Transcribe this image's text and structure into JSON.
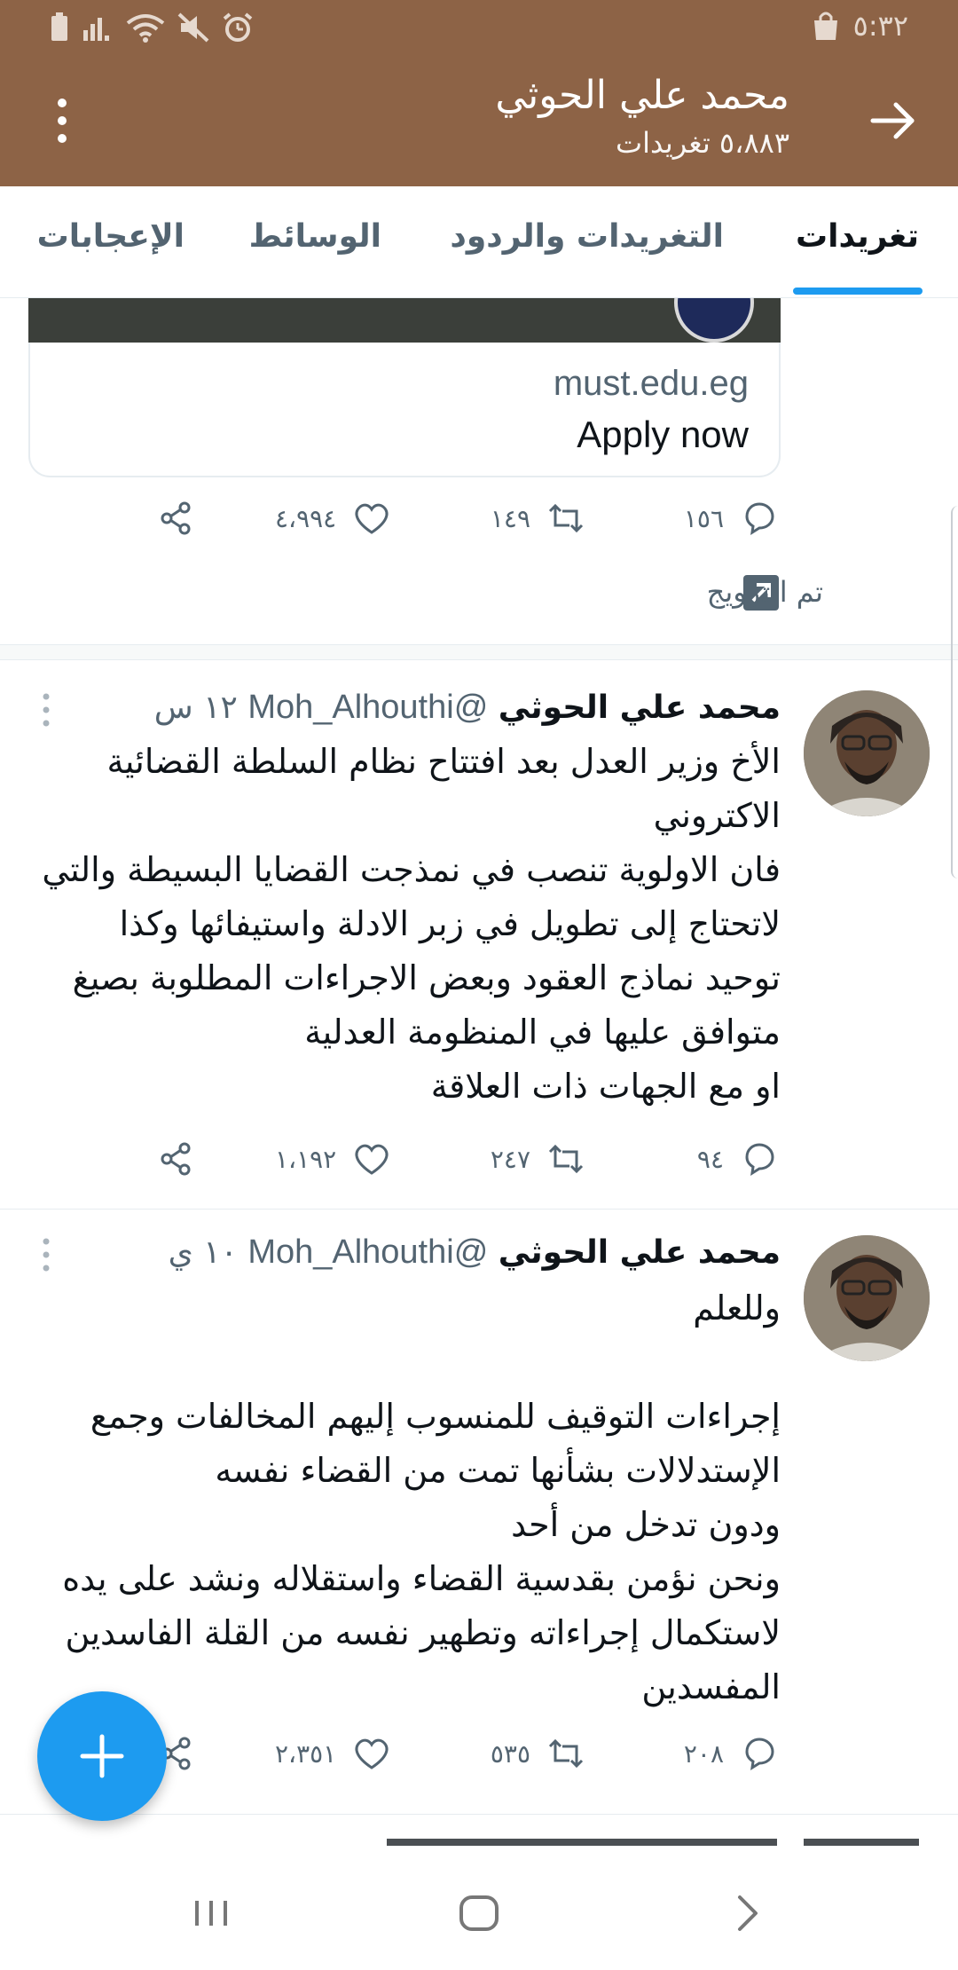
{
  "status_bar": {
    "time": "٥:٣٢"
  },
  "header": {
    "title": "محمد علي الحوثي",
    "subtitle": "٥،٨٨٣ تغريدات"
  },
  "tabs": [
    {
      "label": "تغريدات",
      "active": true
    },
    {
      "label": "التغريدات والردود",
      "active": false
    },
    {
      "label": "الوسائط",
      "active": false
    },
    {
      "label": "الإعجابات",
      "active": false
    }
  ],
  "promoted_card": {
    "domain": "must.edu.eg",
    "cta": "Apply now",
    "reply_count": "١٥٦",
    "retweet_count": "١٤٩",
    "like_count": "٤،٩٩٤",
    "promoted_label": "تم الترويج"
  },
  "tweets": [
    {
      "name": "محمد علي الحوثي",
      "handle": "@Moh_Alhouthi",
      "time": "١٢ س",
      "text": "الأخ وزير العدل بعد افتتاح نظام السلطة القضائية الاكتروني\nفان الاولوية تنصب في نمذجت القضايا البسيطة والتي لاتحتاج إلى تطويل في زبر الادلة واستيفائها وكذا توحيد نماذج العقود وبعض الاجراءات المطلوبة بصيغ متوافق عليها  في المنظومة العدلية\nاو  مع  الجهات ذات العلاقة",
      "reply_count": "٩٤",
      "retweet_count": "٢٤٧",
      "like_count": "١،١٩٢"
    },
    {
      "name": "محمد علي الحوثي",
      "handle": "@Moh_Alhouthi",
      "time": "١٠ ي",
      "text": "وللعلم\n\nإجراءات التوقيف للمنسوب إليهم المخالفات وجمع الإستدلالات بشأنها تمت من القضاء نفسه\nودون تدخل من أحد\n ونحن نؤمن بقدسية القضاء واستقلاله ونشد على يده لاستكمال إجراءاته وتطهير نفسه من القلة الفاسدين المفسدين",
      "reply_count": "٢٠٨",
      "retweet_count": "٥٣٥",
      "like_count": "٢،٣٥١"
    }
  ],
  "icons": {
    "reply": "reply-icon",
    "retweet": "retweet-icon",
    "like": "heart-icon",
    "share": "share-icon",
    "compose": "plus-icon"
  },
  "colors": {
    "header_bg": "#8d6346",
    "accent": "#1d9bf0",
    "secondary_text": "#536471"
  }
}
